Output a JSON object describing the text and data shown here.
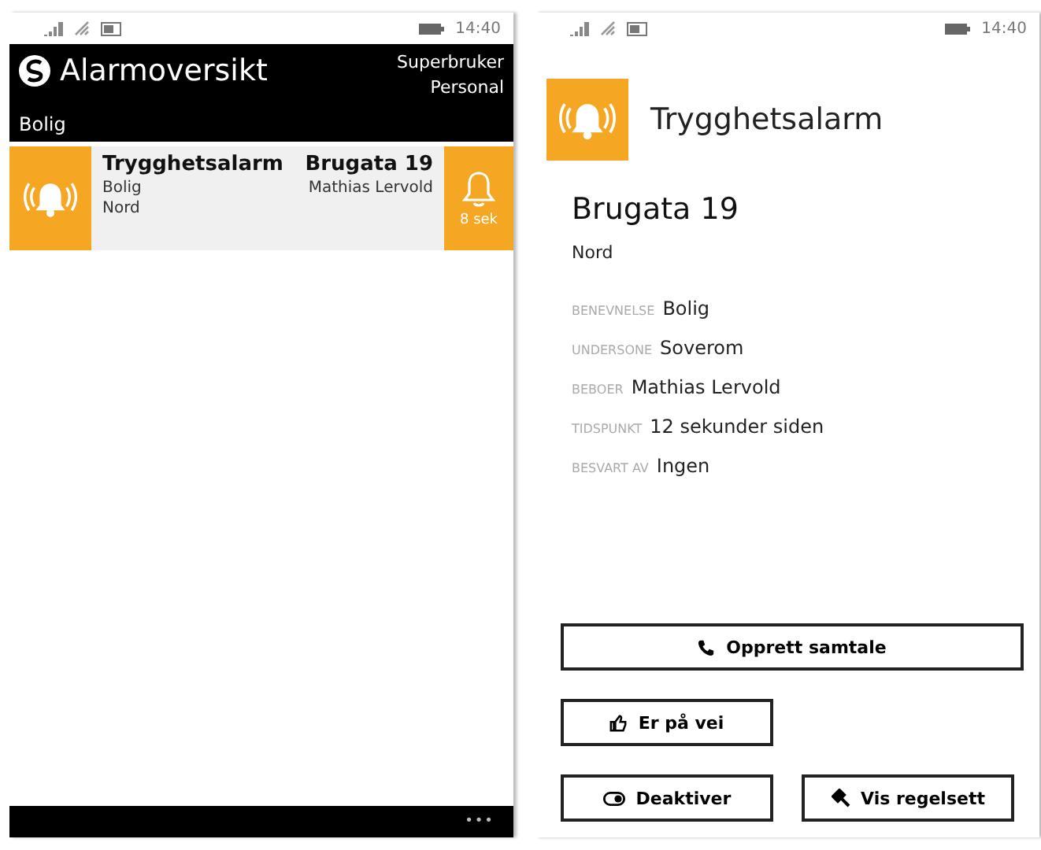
{
  "overview_screen": {
    "status_bar": {
      "time": "14:40"
    },
    "header": {
      "title": "Alarmoversikt",
      "user_lines": [
        "Superbruker",
        "Personal"
      ],
      "section": "Bolig"
    },
    "alarms": [
      {
        "type": "Trygghetsalarm",
        "address": "Brugata 19",
        "zone": "Bolig",
        "resident": "Mathias Lervold",
        "area": "Nord",
        "elapsed": "8 sek"
      }
    ],
    "app_bar": {
      "more": "•••"
    }
  },
  "detail_screen": {
    "status_bar": {
      "time": "14:40"
    },
    "title": "Trygghetsalarm",
    "address": "Brugata 19",
    "area": "Nord",
    "fields": [
      {
        "label": "BENEVNELSE",
        "value": "Bolig"
      },
      {
        "label": "UNDERSONE",
        "value": "Soverom"
      },
      {
        "label": "BEBOER",
        "value": "Mathias Lervold"
      },
      {
        "label": "TIDSPUNKT",
        "value": "12 sekunder siden"
      },
      {
        "label": "BESVART AV",
        "value": "Ingen"
      }
    ],
    "buttons": [
      {
        "label": "Opprett samtale",
        "kind": "phone"
      },
      {
        "label": "Er på vei",
        "kind": "thumb"
      },
      {
        "label": "Deaktiver",
        "kind": "toggle"
      },
      {
        "label": "Vis regelsett",
        "kind": "gavel"
      }
    ]
  }
}
